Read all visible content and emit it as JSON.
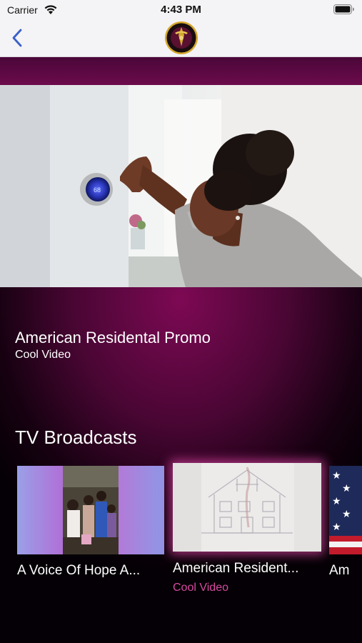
{
  "status_bar": {
    "carrier": "Carrier",
    "time": "4:43 PM"
  },
  "nav": {
    "back_icon": "chevron-left-icon",
    "logo_icon": "channel-logo"
  },
  "featured": {
    "title": "American Residental Promo",
    "subtitle": "Cool Video"
  },
  "broadcasts": {
    "section_title": "TV Broadcasts",
    "items": [
      {
        "title": "A Voice Of Hope A...",
        "subtitle": ""
      },
      {
        "title": "American Resident...",
        "subtitle": "Cool Video"
      },
      {
        "title": "Am",
        "subtitle": ""
      }
    ]
  },
  "colors": {
    "accent": "#d64aa0",
    "nav_tint": "#3a5fc8",
    "background_magenta": "#7d0954",
    "nav_bar": "#f4f3f5"
  }
}
